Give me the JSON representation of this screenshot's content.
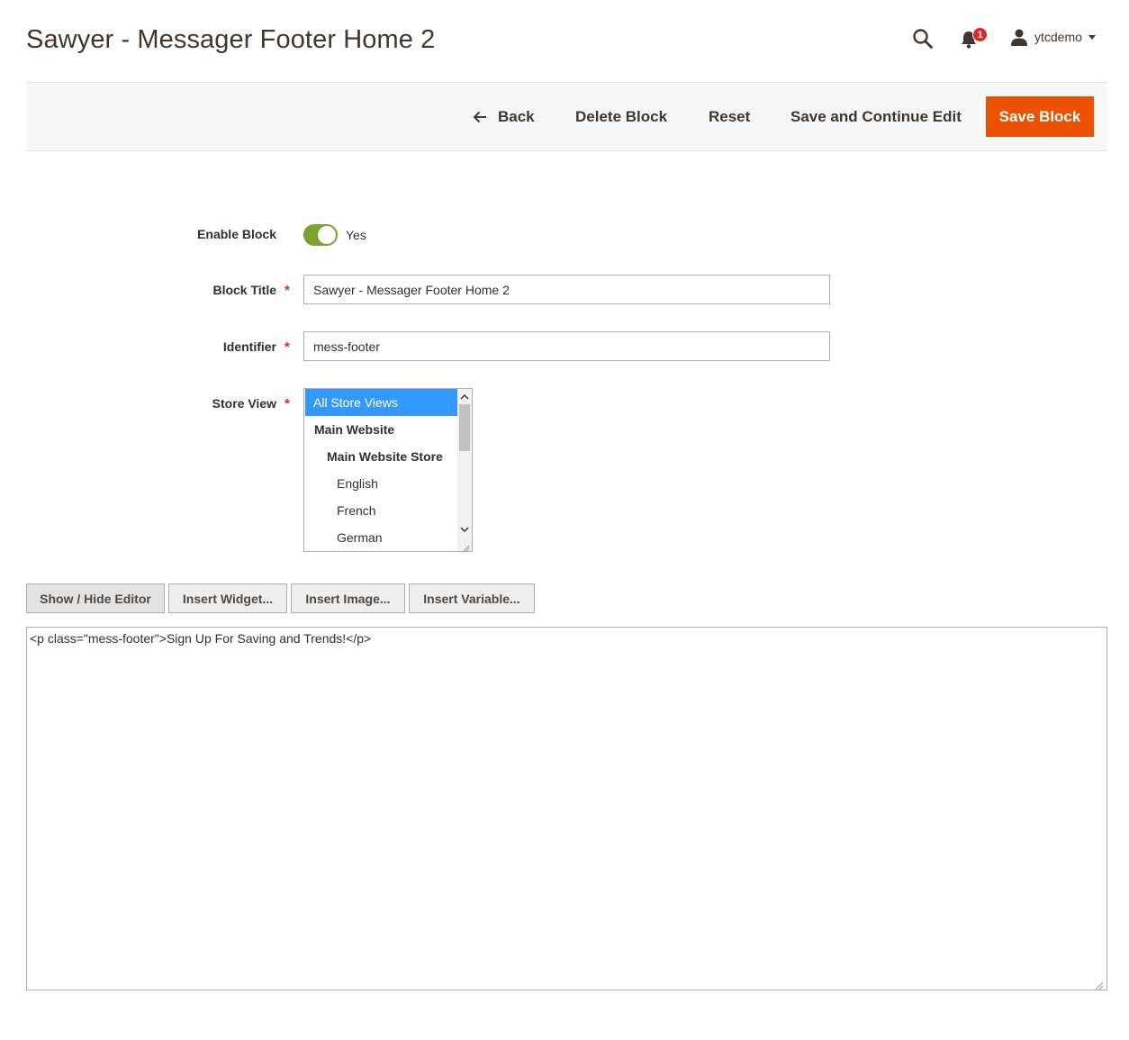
{
  "header": {
    "title": "Sawyer - Messager Footer Home 2",
    "notification_count": "1",
    "user_name": "ytcdemo"
  },
  "toolbar": {
    "back_label": "Back",
    "delete_label": "Delete Block",
    "reset_label": "Reset",
    "save_continue_label": "Save and Continue Edit",
    "save_label": "Save Block"
  },
  "form": {
    "enable_block": {
      "label": "Enable Block",
      "value": "Yes",
      "enabled": true
    },
    "block_title": {
      "label": "Block Title",
      "value": "Sawyer - Messager Footer Home 2",
      "required": "*"
    },
    "identifier": {
      "label": "Identifier",
      "value": "mess-footer",
      "required": "*"
    },
    "store_view": {
      "label": "Store View",
      "required": "*",
      "options": [
        {
          "label": "All Store Views",
          "selected": true,
          "bold": false
        },
        {
          "label": "Main Website",
          "selected": false,
          "bold": true
        },
        {
          "label": "Main Website Store",
          "selected": false,
          "bold": true
        },
        {
          "label": "English",
          "selected": false,
          "bold": false
        },
        {
          "label": "French",
          "selected": false,
          "bold": false
        },
        {
          "label": "German",
          "selected": false,
          "bold": false
        }
      ]
    }
  },
  "editor": {
    "show_hide_label": "Show / Hide Editor",
    "insert_widget_label": "Insert Widget...",
    "insert_image_label": "Insert Image...",
    "insert_variable_label": "Insert Variable...",
    "content": "<p class=\"mess-footer\">Sign Up For Saving and Trends!</p>"
  },
  "colors": {
    "accent": "#eb5202",
    "toggle_on": "#79a22e",
    "selected_option": "#3399ff",
    "badge": "#e22626"
  }
}
